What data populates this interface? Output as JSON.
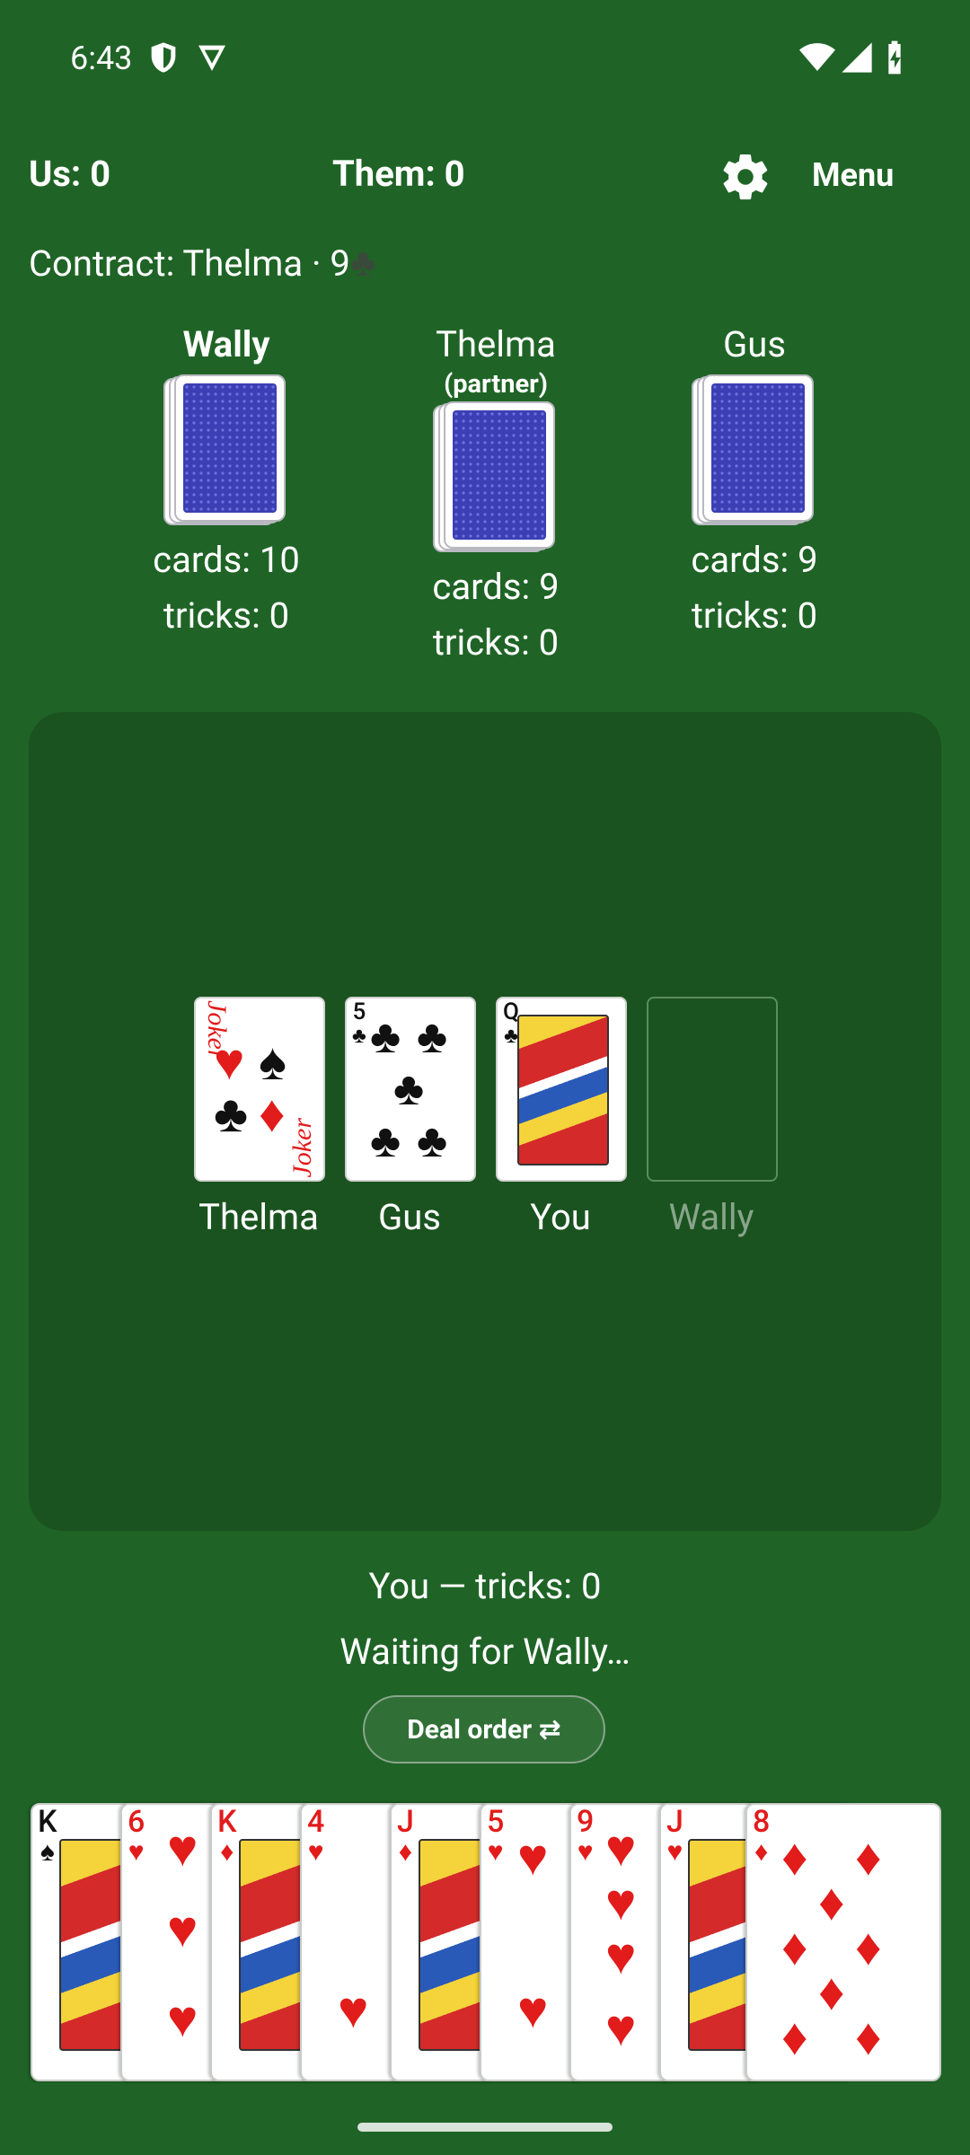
{
  "status_bar": {
    "time": "6:43"
  },
  "header": {
    "us": "Us: 0",
    "them": "Them: 0",
    "menu": "Menu"
  },
  "contract": {
    "text": "Contract: Thelma · 9",
    "suit": "♣"
  },
  "opponents": [
    {
      "name": "Wally",
      "sub": "",
      "cards": "cards: 10",
      "tricks": "tricks: 0",
      "bold": true
    },
    {
      "name": "Thelma",
      "sub": "(partner)",
      "cards": "cards: 9",
      "tricks": "tricks: 0",
      "bold": false
    },
    {
      "name": "Gus",
      "sub": "",
      "cards": "cards: 9",
      "tricks": "tricks: 0",
      "bold": false
    }
  ],
  "trick": {
    "cards": [
      {
        "player": "Thelma",
        "card": "Joker"
      },
      {
        "player": "Gus",
        "card": "5♣"
      },
      {
        "player": "You",
        "card": "Q♣"
      },
      {
        "player": "Wally",
        "card": ""
      }
    ],
    "joker_label": "Joker"
  },
  "you_status": "You — tricks: 0",
  "waiting": "Waiting for Wally…",
  "deal_button": "Deal order ⇄",
  "hand": [
    {
      "rank": "K",
      "suit": "♠",
      "color": "black"
    },
    {
      "rank": "6",
      "suit": "♥",
      "color": "red"
    },
    {
      "rank": "K",
      "suit": "♦",
      "color": "red"
    },
    {
      "rank": "4",
      "suit": "♥",
      "color": "red"
    },
    {
      "rank": "J",
      "suit": "♦",
      "color": "red"
    },
    {
      "rank": "5",
      "suit": "♥",
      "color": "red"
    },
    {
      "rank": "9",
      "suit": "♥",
      "color": "red"
    },
    {
      "rank": "J",
      "suit": "♥",
      "color": "red"
    },
    {
      "rank": "8",
      "suit": "♦",
      "color": "red"
    }
  ],
  "colors": {
    "background": "#1f6426",
    "table": "#1a531f",
    "red_suit": "#e21b1b"
  }
}
